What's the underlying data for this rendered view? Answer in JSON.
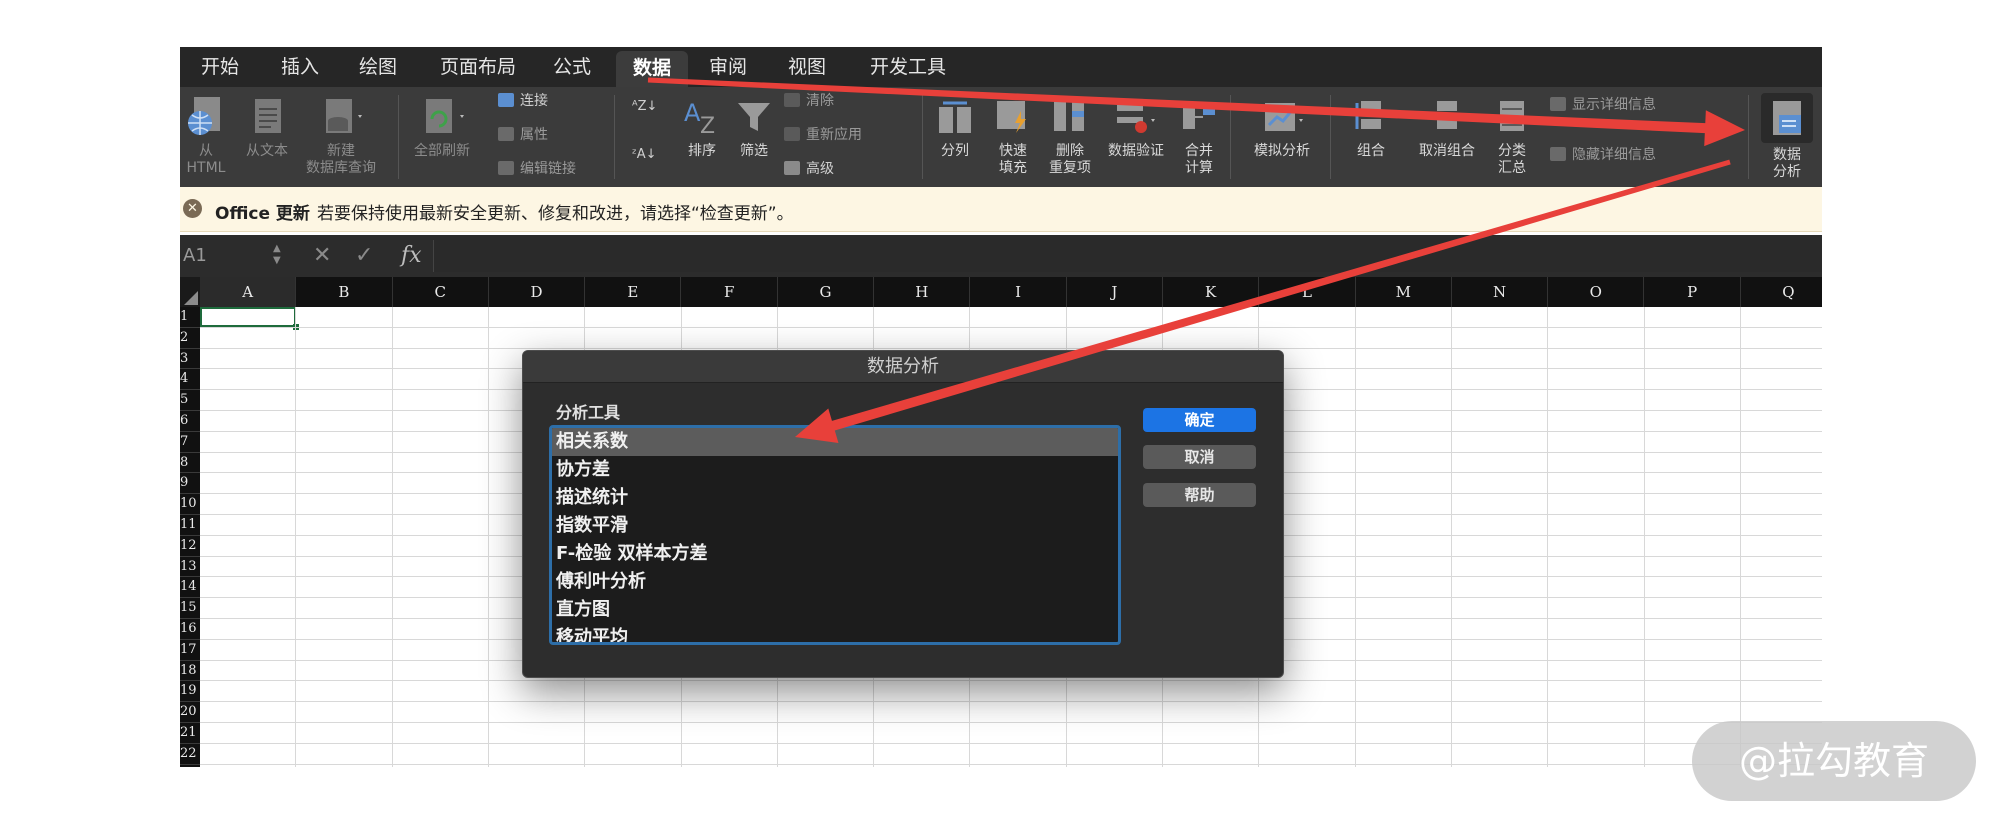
{
  "tabs": [
    "开始",
    "插入",
    "绘图",
    "页面布局",
    "公式",
    "数据",
    "审阅",
    "视图",
    "开发工具"
  ],
  "active_tab": "数据",
  "ribbon": {
    "from_html": [
      "从",
      "HTML"
    ],
    "from_text": "从文本",
    "new_db_query": [
      "新建",
      "数据库查询"
    ],
    "refresh_all": "全部刷新",
    "connections": "连接",
    "properties": "属性",
    "edit_links": "编辑链接",
    "sort": "排序",
    "filter": "筛选",
    "clear": "清除",
    "reapply": "重新应用",
    "advanced": "高级",
    "text_to_columns": "分列",
    "flash_fill": [
      "快速",
      "填充"
    ],
    "remove_duplicates": [
      "删除",
      "重复项"
    ],
    "data_validation": "数据验证",
    "consolidate": [
      "合并",
      "计算"
    ],
    "what_if": "模拟分析",
    "group": "组合",
    "ungroup": "取消组合",
    "subtotal": [
      "分类",
      "汇总"
    ],
    "show_detail": "显示详细信息",
    "hide_detail": "隐藏详细信息",
    "data_analysis": [
      "数据",
      "分析"
    ]
  },
  "notice": {
    "title": "Office 更新",
    "message": "若要保持使用最新安全更新、修复和改进，请选择“检查更新”。"
  },
  "formula_bar": {
    "name_box": "A1",
    "cancel_glyph": "✕",
    "enter_glyph": "✓",
    "fx": "fx"
  },
  "columns": [
    "A",
    "B",
    "C",
    "D",
    "E",
    "F",
    "G",
    "H",
    "I",
    "J",
    "K",
    "L",
    "M",
    "N",
    "O",
    "P",
    "Q"
  ],
  "rows": [
    "1",
    "2",
    "3",
    "4",
    "5",
    "6",
    "7",
    "8",
    "9",
    "10",
    "11",
    "12",
    "13",
    "14",
    "15",
    "16",
    "17",
    "18",
    "19",
    "20",
    "21",
    "22"
  ],
  "dialog": {
    "title": "数据分析",
    "group_label": "分析工具",
    "tools": [
      "相关系数",
      "协方差",
      "描述统计",
      "指数平滑",
      "F-检验 双样本方差",
      "傅利叶分析",
      "直方图",
      "移动平均"
    ],
    "selected_index": 0,
    "ok": "确定",
    "cancel": "取消",
    "help": "帮助"
  },
  "watermark": "@拉勾教育",
  "colors": {
    "arrow": "#e8403a",
    "ok_button": "#1c74e4",
    "list_border": "#2d6ea8",
    "active_cell": "#1e6b3c"
  }
}
